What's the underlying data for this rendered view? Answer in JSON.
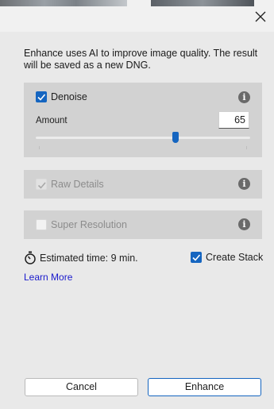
{
  "dialog": {
    "close_icon": "close-icon",
    "intro_text": "Enhance uses AI to improve image quality. The result will be saved as a new DNG."
  },
  "denoise": {
    "label": "Denoise",
    "checked": true,
    "amount_label": "Amount",
    "amount_value": "65",
    "slider_fraction": 0.65,
    "info_icon": "info-icon"
  },
  "raw_details": {
    "label": "Raw Details",
    "checked": true,
    "disabled": true,
    "info_icon": "info-icon"
  },
  "super_resolution": {
    "label": "Super Resolution",
    "checked": false,
    "disabled": true,
    "info_icon": "info-icon"
  },
  "estimate": {
    "icon": "stopwatch-icon",
    "text": "Estimated time: 9 min."
  },
  "create_stack": {
    "label": "Create Stack",
    "checked": true
  },
  "links": {
    "learn_more": "Learn More"
  },
  "buttons": {
    "cancel": "Cancel",
    "enhance": "Enhance"
  },
  "colors": {
    "accent": "#1565c0",
    "panel": "#d2d2d2",
    "background": "#e9e9e9",
    "link": "#1a1acc"
  }
}
